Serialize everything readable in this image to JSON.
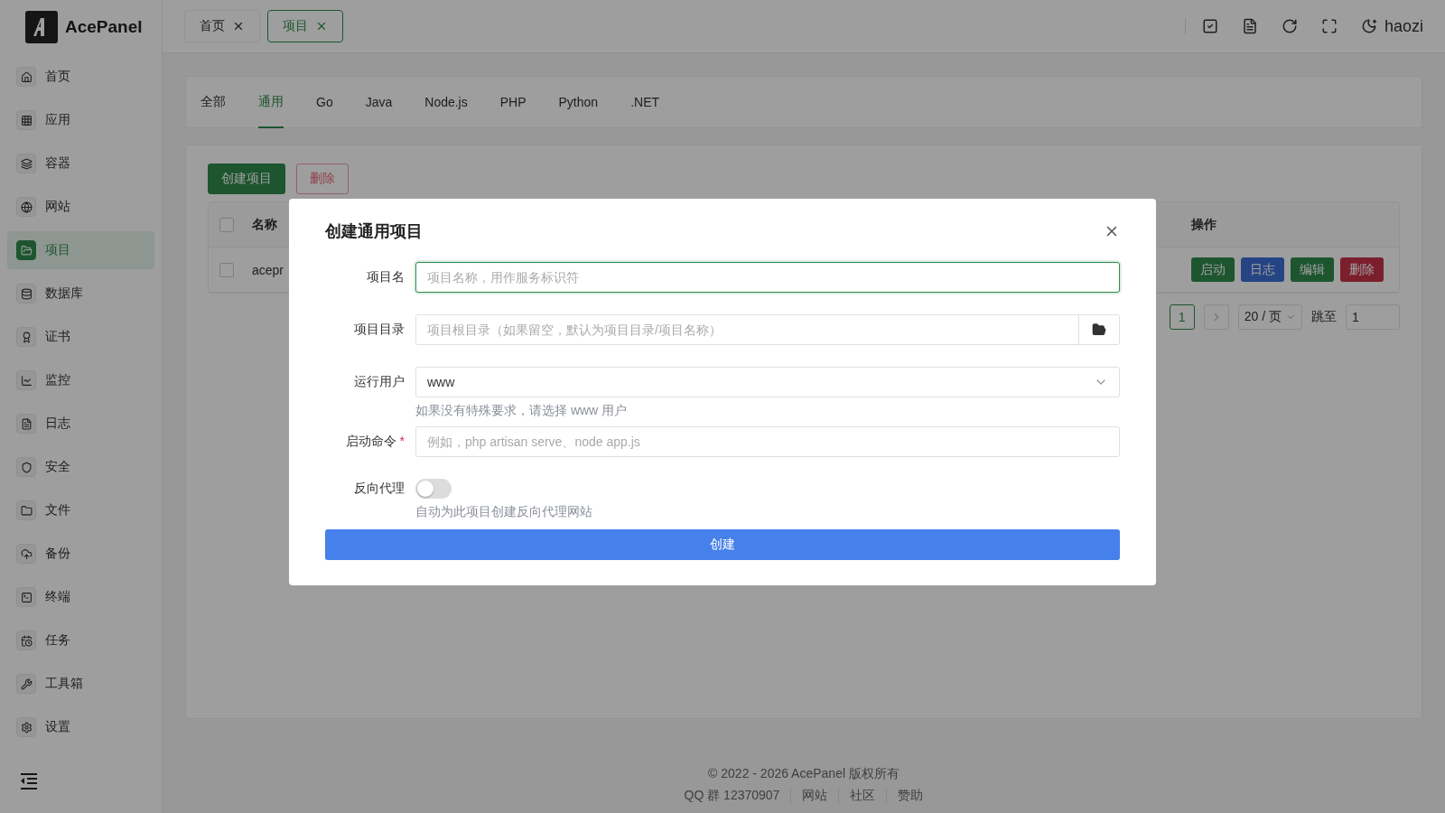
{
  "app": {
    "name": "AcePanel"
  },
  "sidebar": {
    "items": [
      {
        "label": "首页",
        "selected": false
      },
      {
        "label": "应用",
        "selected": false
      },
      {
        "label": "容器",
        "selected": false
      },
      {
        "label": "网站",
        "selected": false
      },
      {
        "label": "项目",
        "selected": true
      },
      {
        "label": "数据库",
        "selected": false
      },
      {
        "label": "证书",
        "selected": false
      },
      {
        "label": "监控",
        "selected": false
      },
      {
        "label": "日志",
        "selected": false
      },
      {
        "label": "安全",
        "selected": false
      },
      {
        "label": "文件",
        "selected": false
      },
      {
        "label": "备份",
        "selected": false
      },
      {
        "label": "终端",
        "selected": false
      },
      {
        "label": "任务",
        "selected": false
      },
      {
        "label": "工具箱",
        "selected": false
      },
      {
        "label": "设置",
        "selected": false
      }
    ]
  },
  "page_tabs": [
    {
      "label": "首页",
      "selected": false
    },
    {
      "label": "项目",
      "selected": true
    }
  ],
  "header": {
    "user": "haozi"
  },
  "category_tabs": [
    {
      "label": "全部",
      "selected": false
    },
    {
      "label": "通用",
      "selected": true
    },
    {
      "label": "Go",
      "selected": false
    },
    {
      "label": "Java",
      "selected": false
    },
    {
      "label": "Node.js",
      "selected": false
    },
    {
      "label": "PHP",
      "selected": false
    },
    {
      "label": "Python",
      "selected": false
    },
    {
      "label": ".NET",
      "selected": false
    }
  ],
  "toolbar": {
    "buttons": [
      {
        "label": "创建项目",
        "kind": "primary"
      },
      {
        "label": "删除",
        "kind": "danger"
      }
    ]
  },
  "table": {
    "columns": [
      "名称",
      "操作"
    ],
    "all_checked": false,
    "rows": [
      {
        "name": "acepr",
        "checked": false,
        "actions": [
          {
            "label": "启动",
            "kind": "start"
          },
          {
            "label": "日志",
            "kind": "log"
          },
          {
            "label": "编辑",
            "kind": "edit"
          },
          {
            "label": "删除",
            "kind": "delete"
          }
        ]
      }
    ]
  },
  "pagination": {
    "current": "1",
    "page_size": "20 / 页",
    "jump_label": "跳至",
    "jump_value": "1"
  },
  "footer": {
    "copyright": "© 2022 - 2026 AcePanel 版权所有",
    "links": [
      "QQ 群 12370907",
      "网站",
      "社区",
      "赞助"
    ]
  },
  "modal": {
    "title": "创建通用项目",
    "submit": "创建",
    "required_mark": "*",
    "fields": [
      {
        "kind": "text",
        "label": "项目名",
        "placeholder": "项目名称，用作服务标识符",
        "focused": true,
        "required": false
      },
      {
        "kind": "path",
        "label": "项目目录",
        "placeholder": "项目根目录（如果留空，默认为项目目录/项目名称）",
        "focused": false,
        "required": false
      },
      {
        "kind": "select",
        "label": "运行用户",
        "value": "www",
        "help": "如果没有特殊要求，请选择 www 用户",
        "focused": false,
        "required": false
      },
      {
        "kind": "text",
        "label": "启动命令",
        "placeholder": "例如，php artisan serve、node app.js",
        "focused": false,
        "required": true
      },
      {
        "kind": "switch",
        "label": "反向代理",
        "on": false,
        "help": "自动为此项目创建反向代理网站",
        "required": false
      }
    ]
  }
}
